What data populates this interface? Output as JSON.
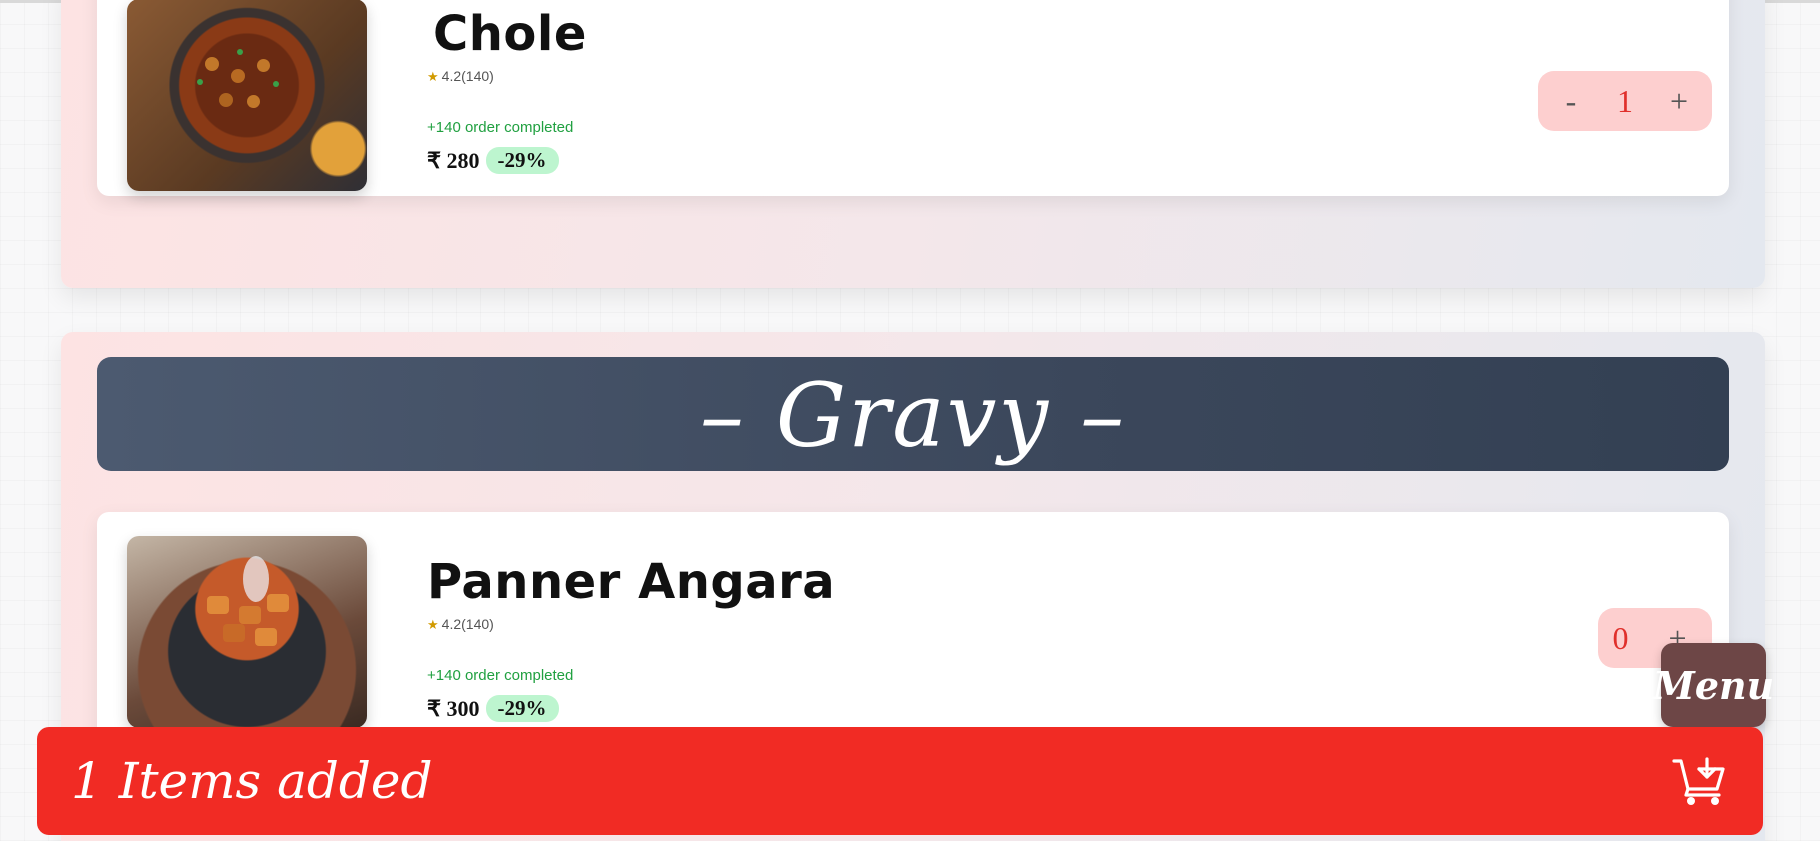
{
  "sections": [
    {
      "items": [
        {
          "name": "Chole",
          "rating": "4.2(140)",
          "orders": "+140 order completed",
          "price": "₹ 280",
          "discount": "-29%",
          "quantity": "1",
          "minus": "-",
          "plus": "+"
        }
      ]
    },
    {
      "title": "– Gravy –",
      "items": [
        {
          "name": "Panner Angara",
          "rating": "4.2(140)",
          "orders": "+140 order completed",
          "price": "₹ 300",
          "discount": "-29%",
          "quantity": "0",
          "plus": "+"
        }
      ]
    }
  ],
  "menu_button": "Menu",
  "cart": {
    "label": "1 Items added",
    "icon": "add-shopping-cart-icon"
  },
  "colors": {
    "accent_red": "#f12b24",
    "stepper_bg": "#fdcfcf",
    "discount_bg": "#bdf5cf",
    "orders_green": "#20a040",
    "banner_slate": "#3b475b",
    "menu_brown": "#6d4646"
  }
}
